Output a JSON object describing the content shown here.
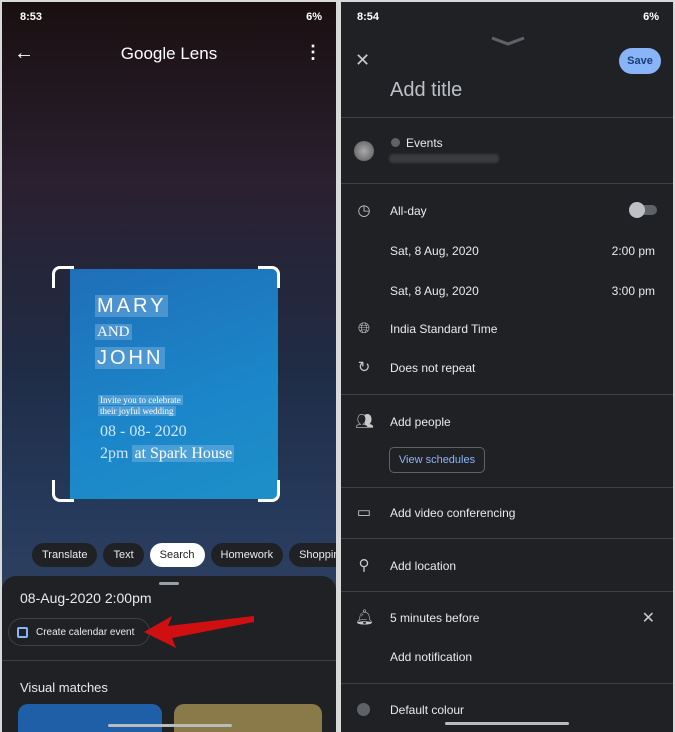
{
  "left": {
    "status": {
      "time": "8:53",
      "battery": "6%"
    },
    "header": {
      "title": "Google Lens",
      "back_icon": "arrow-left-icon",
      "menu_icon": "more-vert-icon"
    },
    "card": {
      "line1": "MARY",
      "line2": "AND",
      "line3": "JOHN",
      "invite1": "Invite you to celebrate",
      "invite2": "their joyful wedding",
      "date": "08 - 08- 2020",
      "time": "2pm",
      "place": "at Spark House"
    },
    "chips": [
      "Translate",
      "Text",
      "Search",
      "Homework",
      "Shopping"
    ],
    "active_chip": "Search",
    "result": {
      "datetime": "08-Aug-2020 2:00pm",
      "action": "Create calendar event"
    },
    "visual_matches": "Visual matches",
    "arrow_color": "#d01010"
  },
  "right": {
    "status": {
      "time": "8:54",
      "battery": "6%"
    },
    "save": "Save",
    "title_placeholder": "Add title",
    "calendar": "Events",
    "all_day": "All-day",
    "start": {
      "date": "Sat, 8 Aug, 2020",
      "time": "2:00 pm"
    },
    "end": {
      "date": "Sat, 8 Aug, 2020",
      "time": "3:00 pm"
    },
    "timezone": "India Standard Time",
    "repeat": "Does not repeat",
    "add_people": "Add people",
    "view_schedules": "View schedules",
    "video": "Add video conferencing",
    "location": "Add location",
    "notification": "5 minutes before",
    "add_notification": "Add notification",
    "colour": "Default colour",
    "accent": "#8ab4f8"
  }
}
